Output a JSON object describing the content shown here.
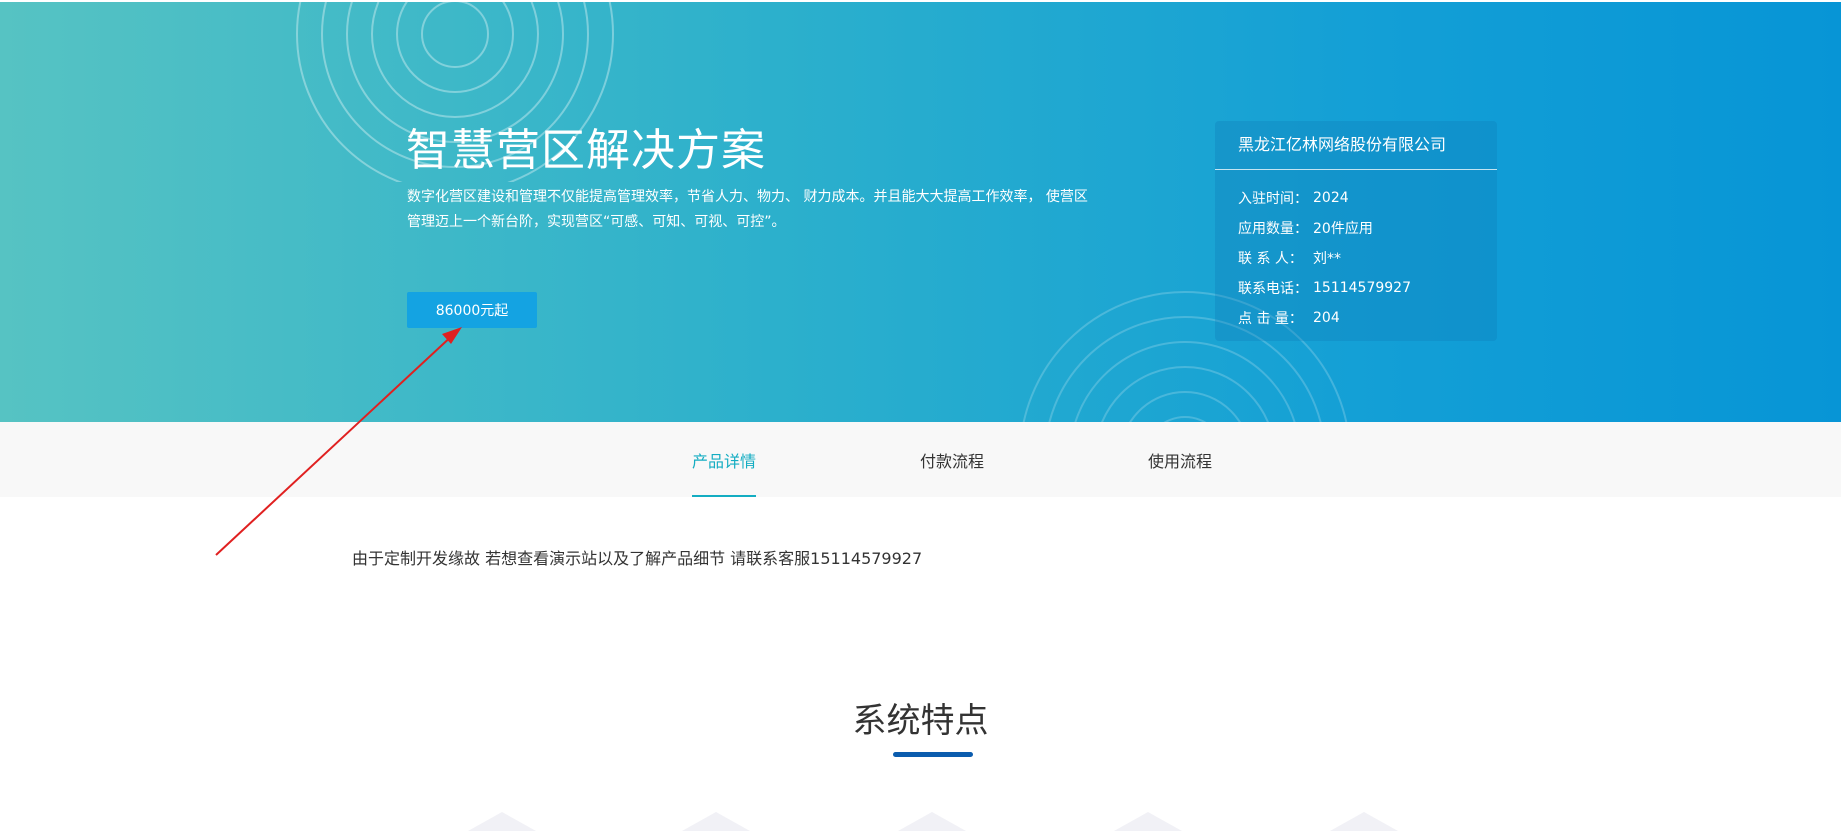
{
  "hero": {
    "title": "智慧营区解决方案",
    "description": "数字化营区建设和管理不仅能提高管理效率，节省人力、物力、 财力成本。并且能大大提高工作效率， 使营区管理迈上一个新台阶，实现营区“可感、可知、可视、可控”。",
    "price_button": "86000元起"
  },
  "info_card": {
    "company": "黑龙江亿林网络股份有限公司",
    "rows": [
      {
        "key": "入驻时间：",
        "value": "2024"
      },
      {
        "key": "应用数量：",
        "value": "20件应用"
      },
      {
        "key": "联 系 人：",
        "value": "刘**"
      },
      {
        "key": "联系电话：",
        "value": "15114579927"
      },
      {
        "key": "点 击 量：",
        "value": "204"
      }
    ]
  },
  "tabs": [
    {
      "label": "产品详情",
      "active": true
    },
    {
      "label": "付款流程",
      "active": false
    },
    {
      "label": "使用流程",
      "active": false
    }
  ],
  "notice": "由于定制开发缘故 若想查看演示站以及了解产品细节 请联系客服15114579927",
  "section": {
    "title": "系统特点"
  },
  "colors": {
    "hero_start": "#56c3c3",
    "hero_end": "#0795d6",
    "accent": "#14adc2",
    "button": "#14a3e2",
    "underline": "#0b5cae",
    "annotation_arrow": "#e02020"
  }
}
